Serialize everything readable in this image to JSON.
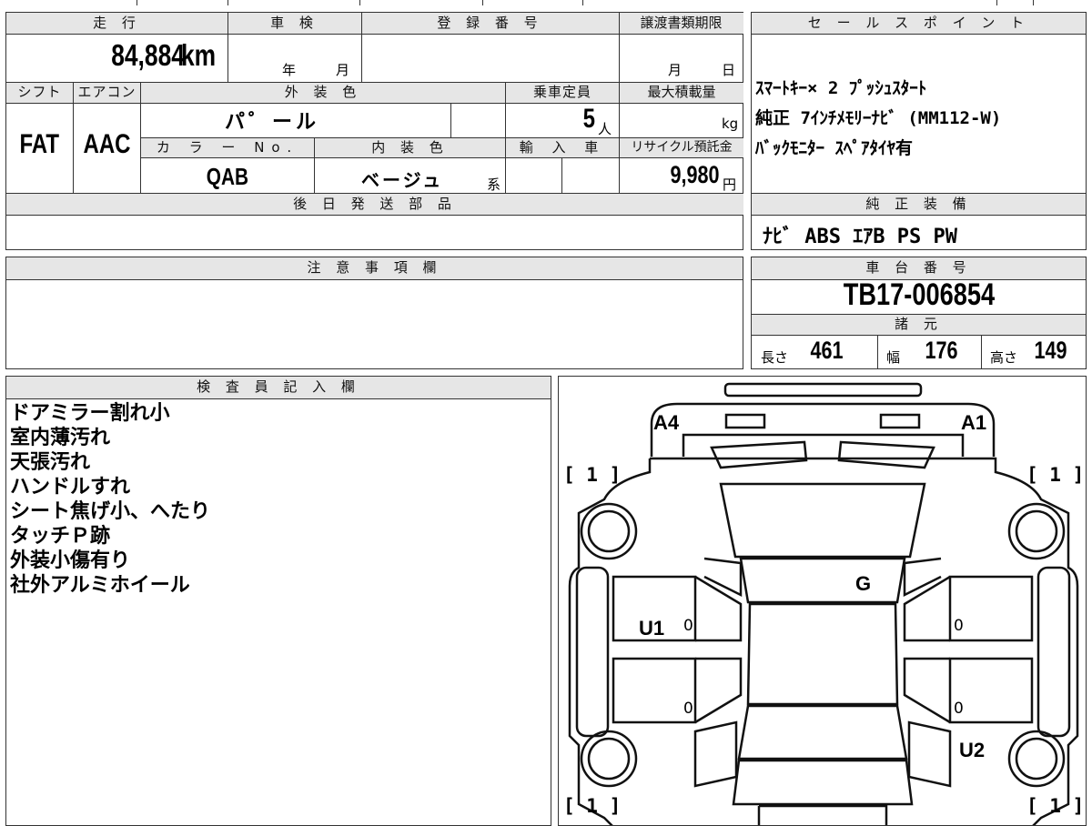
{
  "top_table": {
    "mileage_header": "走 行",
    "mileage_value": "84,884",
    "mileage_unit": "km",
    "inspection_header": "車 検",
    "inspection_year_label": "年",
    "inspection_month_label": "月",
    "registration_header": "登 録 番 号",
    "transfer_header": "譲渡書類期限",
    "transfer_month_label": "月",
    "transfer_day_label": "日",
    "shift_header": "シフト",
    "shift_value": "FAT",
    "ac_header": "エアコン",
    "ac_value": "AAC",
    "exterior_header": "外 装 色",
    "exterior_value": "パ゜ール",
    "capacity_header": "乗車定員",
    "capacity_value": "5",
    "capacity_unit": "人",
    "max_load_header": "最大積載量",
    "max_load_unit": "kg",
    "color_no_header": "カ ラ ー No.",
    "color_no_value": "QAB",
    "interior_header": "内 装 色",
    "interior_value": "ベージュ",
    "interior_suffix": "系",
    "import_header": "輸 入 車",
    "recycle_header": "リサイクル預託金",
    "recycle_value": "9,980",
    "recycle_unit": "円",
    "later_parts_header": "後 日 発 送 部 品"
  },
  "sales_points": {
    "header": "セ ー ル ス ポ イ ン ト",
    "lines": [
      "ｽﾏｰﾄｷｰ× 2  ﾌﾟｯｼｭｽﾀｰﾄ",
      "純正 7ｲﾝﾁﾒﾓﾘｰﾅﾋﾞ (MM112-W)",
      "ﾊﾞｯｸﾓﾆﾀｰ ｽﾍﾟｱﾀｲﾔ有"
    ]
  },
  "equipment": {
    "header": "純 正 装 備",
    "value": "ﾅﾋﾞ ABS ｴｱB PS PW"
  },
  "caution": {
    "header": "注 意 事 項 欄"
  },
  "chassis": {
    "header": "車 台 番 号",
    "value": "TB17-006854",
    "specs_header": "諸 元",
    "length_label": "長さ",
    "length_value": "461",
    "width_label": "幅",
    "width_value": "176",
    "height_label": "高さ",
    "height_value": "149"
  },
  "inspector": {
    "header": "検 査 員 記 入 欄",
    "notes": [
      "ドアミラー割れ小",
      "室内薄汚れ",
      "天張汚れ",
      "ハンドルすれ",
      "シート焦げ小、へたり",
      "タッチＰ跡",
      "外装小傷有り",
      "社外アルミホイール"
    ]
  },
  "diagram": {
    "marks": {
      "a4": "A4",
      "a1": "A1",
      "g": "G",
      "u1": "U1",
      "u2": "U2"
    },
    "tire_front_left": "[ 1 ]",
    "tire_front_right": "[ 1 ]",
    "tire_rear_left": "[ 1 ]",
    "tire_rear_right": "[ 1 ]",
    "zero": "0"
  }
}
